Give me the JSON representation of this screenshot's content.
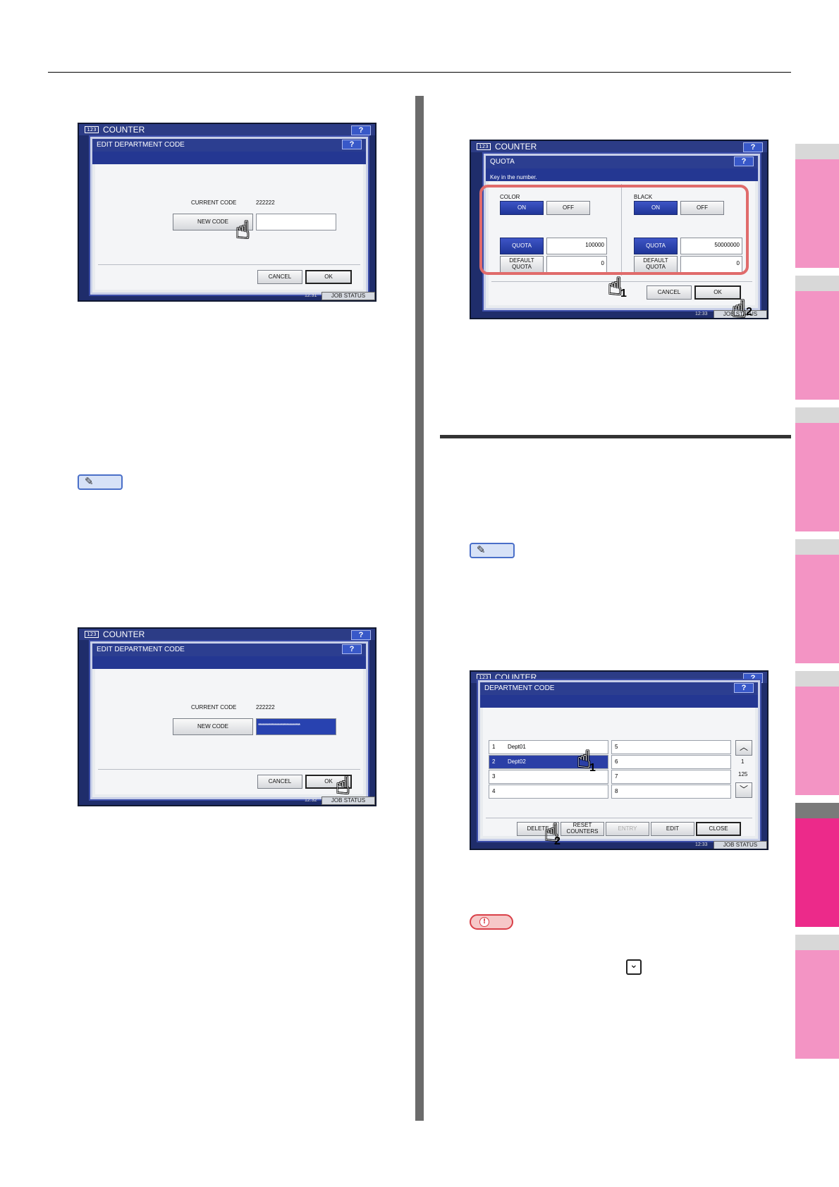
{
  "panel1": {
    "app_title": "COUNTER",
    "help": "?",
    "dialog_title": "EDIT DEPARTMENT CODE",
    "current_code_label": "CURRENT CODE",
    "current_code_value": "222222",
    "new_code_label": "NEW CODE",
    "new_code_value": "",
    "cancel_label": "CANCEL",
    "ok_label": "OK",
    "job_status_label": "JOB STATUS",
    "clock": "12:31"
  },
  "panel2": {
    "app_title": "COUNTER",
    "help": "?",
    "dialog_title": "EDIT DEPARTMENT CODE",
    "current_code_label": "CURRENT CODE",
    "current_code_value": "222222",
    "new_code_label": "NEW CODE",
    "new_code_value": "****************************",
    "cancel_label": "CANCEL",
    "ok_label": "OK",
    "job_status_label": "JOB STATUS",
    "clock": "12:32"
  },
  "panel3": {
    "app_title": "COUNTER",
    "help": "?",
    "dialog_title": "QUOTA",
    "instruction": "Key in the number.",
    "color_label": "COLOR",
    "black_label": "BLACK",
    "on_label": "ON",
    "off_label": "OFF",
    "quota_label": "QUOTA",
    "default_quota_label": "DEFAULT QUOTA",
    "color_quota": "100000",
    "color_default_quota": "0",
    "black_quota": "50000000",
    "black_default_quota": "0",
    "cancel_label": "CANCEL",
    "ok_label": "OK",
    "job_status_label": "JOB STATUS",
    "clock": "12:33",
    "step1": "1",
    "step2": "2"
  },
  "panel4": {
    "app_title": "COUNTER",
    "help": "?",
    "dialog_title": "DEPARTMENT CODE",
    "rows_left": [
      {
        "num": "1",
        "name": "Dept01"
      },
      {
        "num": "2",
        "name": "Dept02"
      },
      {
        "num": "3",
        "name": ""
      },
      {
        "num": "4",
        "name": ""
      }
    ],
    "rows_right": [
      {
        "num": "5",
        "name": ""
      },
      {
        "num": "6",
        "name": ""
      },
      {
        "num": "7",
        "name": ""
      },
      {
        "num": "8",
        "name": ""
      }
    ],
    "page_current": "1",
    "page_total": "125",
    "delete_label": "DELETE",
    "reset_counters_label": "RESET COUNTERS",
    "entry_label": "ENTRY",
    "edit_label": "EDIT",
    "close_label": "CLOSE",
    "job_status_label": "JOB STATUS",
    "clock": "12:33",
    "step1": "1",
    "step2": "2"
  },
  "colors": {
    "accent_blue": "#2c3e90",
    "highlight_red": "#e06b6b",
    "tab_pink": "#f394c4",
    "tab_active": "#ec2a8a"
  },
  "icons": [
    "memo-icon",
    "note-icon",
    "chevron-down-icon",
    "pointing-hand-icon"
  ]
}
